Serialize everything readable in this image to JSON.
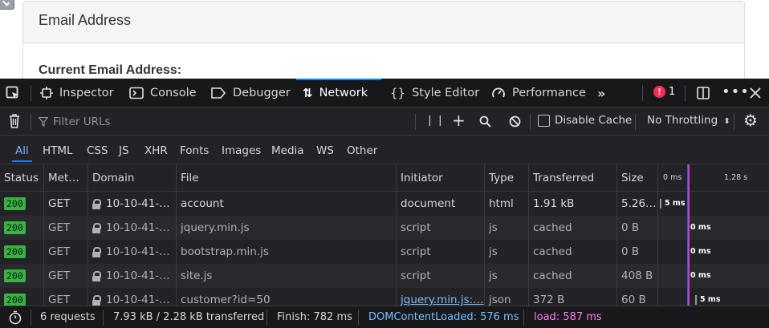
{
  "page": {
    "panel_heading": "Email Address",
    "current_email_label": "Current Email Address:"
  },
  "devtools": {
    "tabs": [
      {
        "label": "Inspector",
        "icon": "inspector-icon"
      },
      {
        "label": "Console",
        "icon": "console-icon"
      },
      {
        "label": "Debugger",
        "icon": "debugger-icon"
      },
      {
        "label": "Network",
        "icon": "network-icon",
        "active": true
      },
      {
        "label": "Style Editor",
        "icon": "style-editor-icon"
      },
      {
        "label": "Performance",
        "icon": "performance-icon"
      }
    ],
    "error_count": "1",
    "filter_placeholder": "Filter URLs",
    "disable_cache_label": "Disable Cache",
    "throttling": "No Throttling",
    "types": [
      "All",
      "HTML",
      "CSS",
      "JS",
      "XHR",
      "Fonts",
      "Images",
      "Media",
      "WS",
      "Other"
    ],
    "active_type": "All",
    "columns": [
      "Status",
      "Met…",
      "Domain",
      "File",
      "Initiator",
      "Type",
      "Transferred",
      "Size"
    ],
    "waterfall_ticks": [
      "0 ms",
      "1.28 s"
    ],
    "rows": [
      {
        "status": "200",
        "method": "GET",
        "domain": "10-10-41-…",
        "file": "account",
        "initiator": "document",
        "type": "html",
        "transferred": "1.91 kB",
        "size": "5.26…",
        "timing": "5 ms"
      },
      {
        "status": "200",
        "method": "GET",
        "domain": "10-10-41-…",
        "file": "jquery.min.js",
        "initiator": "script",
        "type": "js",
        "transferred": "cached",
        "size": "0 B",
        "timing": "0 ms"
      },
      {
        "status": "200",
        "method": "GET",
        "domain": "10-10-41-…",
        "file": "bootstrap.min.js",
        "initiator": "script",
        "type": "js",
        "transferred": "cached",
        "size": "0 B",
        "timing": "0 ms"
      },
      {
        "status": "200",
        "method": "GET",
        "domain": "10-10-41-…",
        "file": "site.js",
        "initiator": "script",
        "type": "js",
        "transferred": "cached",
        "size": "408 B",
        "timing": "0 ms"
      },
      {
        "status": "200",
        "method": "GET",
        "domain": "10-10-41-…",
        "file": "customer?id=50",
        "initiator": "jquery.min.js:…",
        "type": "json",
        "transferred": "372 B",
        "size": "60 B",
        "timing": "5 ms"
      }
    ],
    "statusbar": {
      "requests": "6 requests",
      "transferred": "7.93 kB / 2.28 kB transferred",
      "finish": "Finish: 782 ms",
      "dom_content_loaded": "DOMContentLoaded: 576 ms",
      "load": "load: 587 ms"
    },
    "colors": {
      "status_ok": "#33b53f",
      "dom_content_loaded": "#75bfff",
      "load": "#ff7de9",
      "accent": "#0a84ff",
      "error": "#ff2a51"
    }
  }
}
